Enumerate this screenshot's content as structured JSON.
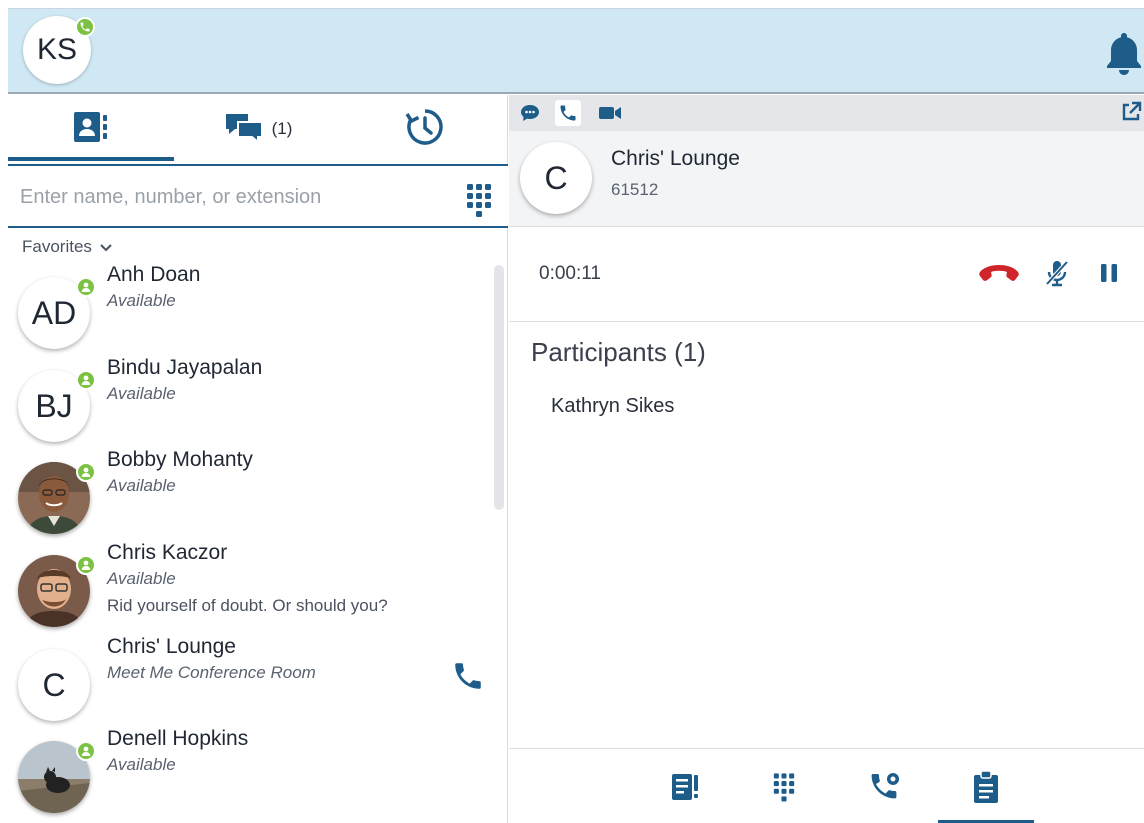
{
  "header": {
    "user_initials": "KS",
    "status_icon": "phone-icon",
    "notification_icon": "bell-icon"
  },
  "left_panel": {
    "tabs": [
      {
        "name": "contacts",
        "icon": "contacts-icon",
        "active": true
      },
      {
        "name": "chats",
        "icon": "chat-bubbles-icon",
        "count": "(1)"
      },
      {
        "name": "history",
        "icon": "history-clock-icon"
      }
    ],
    "search": {
      "placeholder": "Enter name, number, or extension",
      "value": ""
    },
    "favorites_label": "Favorites",
    "contacts": [
      {
        "initials": "AD",
        "name": "Anh Doan",
        "status": "Available",
        "presence": "available"
      },
      {
        "initials": "BJ",
        "name": "Bindu Jayapalan",
        "status": "Available",
        "presence": "available"
      },
      {
        "initials": "",
        "name": "Bobby Mohanty",
        "status": "Available",
        "presence": "available",
        "photo": true
      },
      {
        "initials": "",
        "name": "Chris Kaczor",
        "status": "Available",
        "note": "Rid yourself of doubt. Or should you?",
        "presence": "available",
        "photo": true
      },
      {
        "initials": "C",
        "name": "Chris' Lounge",
        "status": "Meet Me Conference Room",
        "call_icon": "phone-icon"
      },
      {
        "initials": "",
        "name": "Denell Hopkins",
        "status": "Available",
        "presence": "available",
        "photo": true
      }
    ]
  },
  "right_panel": {
    "modes": [
      "chat-icon",
      "phone-icon",
      "video-icon"
    ],
    "active_mode": "phone-icon",
    "call": {
      "initials": "C",
      "name": "Chris' Lounge",
      "extension": "61512",
      "timer": "0:00:11"
    },
    "participants_title": "Participants (1)",
    "participants": [
      "Kathryn Sikes"
    ],
    "bottom_tools": [
      "notes-alert-icon",
      "dialpad-icon",
      "call-transfer-icon",
      "clipboard-icon"
    ],
    "colors": {
      "accent": "#1e5c89",
      "hangup": "#d0242b",
      "presence": "#7cc242",
      "header_bg": "#cfe8f3"
    }
  }
}
